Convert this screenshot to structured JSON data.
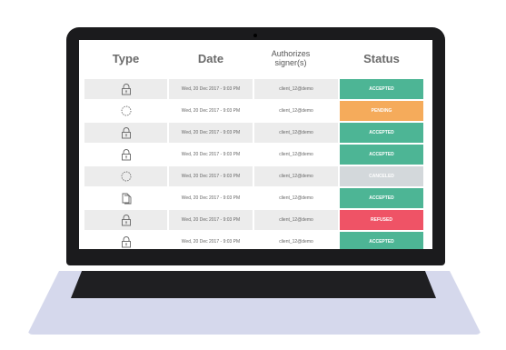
{
  "table": {
    "headers": {
      "type": "Type",
      "date": "Date",
      "signer": "Authorizes signer(s)",
      "status": "Status"
    },
    "rows": [
      {
        "icon": "lock-icon",
        "date": "Wed, 20 Dec 2017 - 9:03 PM",
        "signer": "client_12@demo",
        "status": "ACCEPTED",
        "status_color": "#4db595"
      },
      {
        "icon": "spinner-icon",
        "date": "Wed, 20 Dec 2017 - 9:03 PM",
        "signer": "client_12@demo",
        "status": "PENDING",
        "status_color": "#f5ab5b"
      },
      {
        "icon": "lock-icon",
        "date": "Wed, 20 Dec 2017 - 9:03 PM",
        "signer": "client_12@demo",
        "status": "ACCEPTED",
        "status_color": "#4db595"
      },
      {
        "icon": "lock-icon",
        "date": "Wed, 20 Dec 2017 - 9:03 PM",
        "signer": "client_12@demo",
        "status": "ACCEPTED",
        "status_color": "#4db595"
      },
      {
        "icon": "spinner-icon",
        "date": "Wed, 20 Dec 2017 - 9:03 PM",
        "signer": "client_12@demo",
        "status": "CANCELED",
        "status_color": "#d3d8db"
      },
      {
        "icon": "documents-icon",
        "date": "Wed, 20 Dec 2017 - 9:03 PM",
        "signer": "client_12@demo",
        "status": "ACCEPTED",
        "status_color": "#4db595"
      },
      {
        "icon": "lock-icon",
        "date": "Wed, 20 Dec 2017 - 9:03 PM",
        "signer": "client_12@demo",
        "status": "REFUSED",
        "status_color": "#ef5366"
      },
      {
        "icon": "lock-icon",
        "date": "Wed, 20 Dec 2017 - 9:03 PM",
        "signer": "client_12@demo",
        "status": "ACCEPTED",
        "status_color": "#4db595"
      }
    ]
  }
}
